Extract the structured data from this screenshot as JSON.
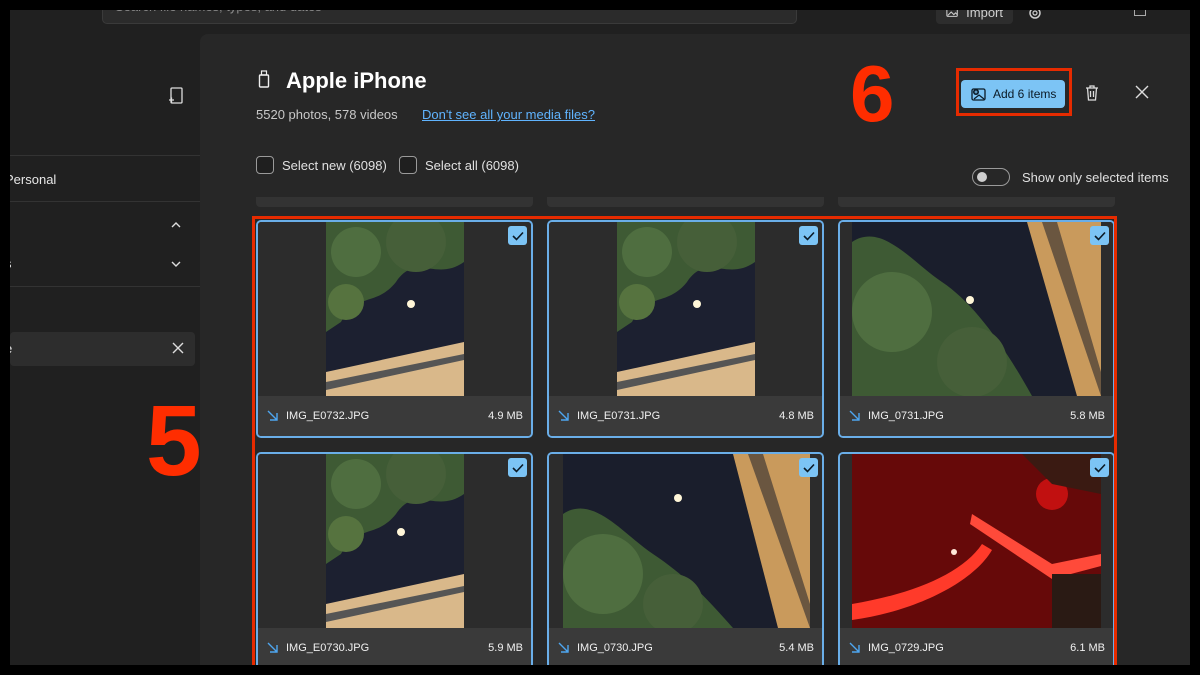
{
  "search": {
    "placeholder": "Search file names, types, and dates"
  },
  "toolbar": {
    "import_label": "Import"
  },
  "sidebar": {
    "items": [
      {
        "label": "Personal"
      },
      {
        "label": "s"
      },
      {
        "label": "e"
      }
    ]
  },
  "dialog": {
    "title": "Apple iPhone",
    "subtitle": "5520 photos, 578 videos",
    "link": "Don't see all your media files?",
    "add_button": "Add 6 items",
    "select_new": "Select new (6098)",
    "select_all": "Select all (6098)",
    "toggle_label": "Show only selected items"
  },
  "annotations": {
    "step_grid": "5",
    "step_add": "6"
  },
  "photos": [
    {
      "name": "IMG_E0732.JPG",
      "size": "4.9 MB",
      "selected": true
    },
    {
      "name": "IMG_E0731.JPG",
      "size": "4.8 MB",
      "selected": true
    },
    {
      "name": "IMG_0731.JPG",
      "size": "5.8 MB",
      "selected": true
    },
    {
      "name": "IMG_E0730.JPG",
      "size": "5.9 MB",
      "selected": true
    },
    {
      "name": "IMG_0730.JPG",
      "size": "5.4 MB",
      "selected": true
    },
    {
      "name": "IMG_0729.JPG",
      "size": "6.1 MB",
      "selected": true
    }
  ],
  "colors": {
    "accent": "#7cc4f5",
    "highlight": "#e62b00",
    "annotation": "#ff2d00"
  }
}
